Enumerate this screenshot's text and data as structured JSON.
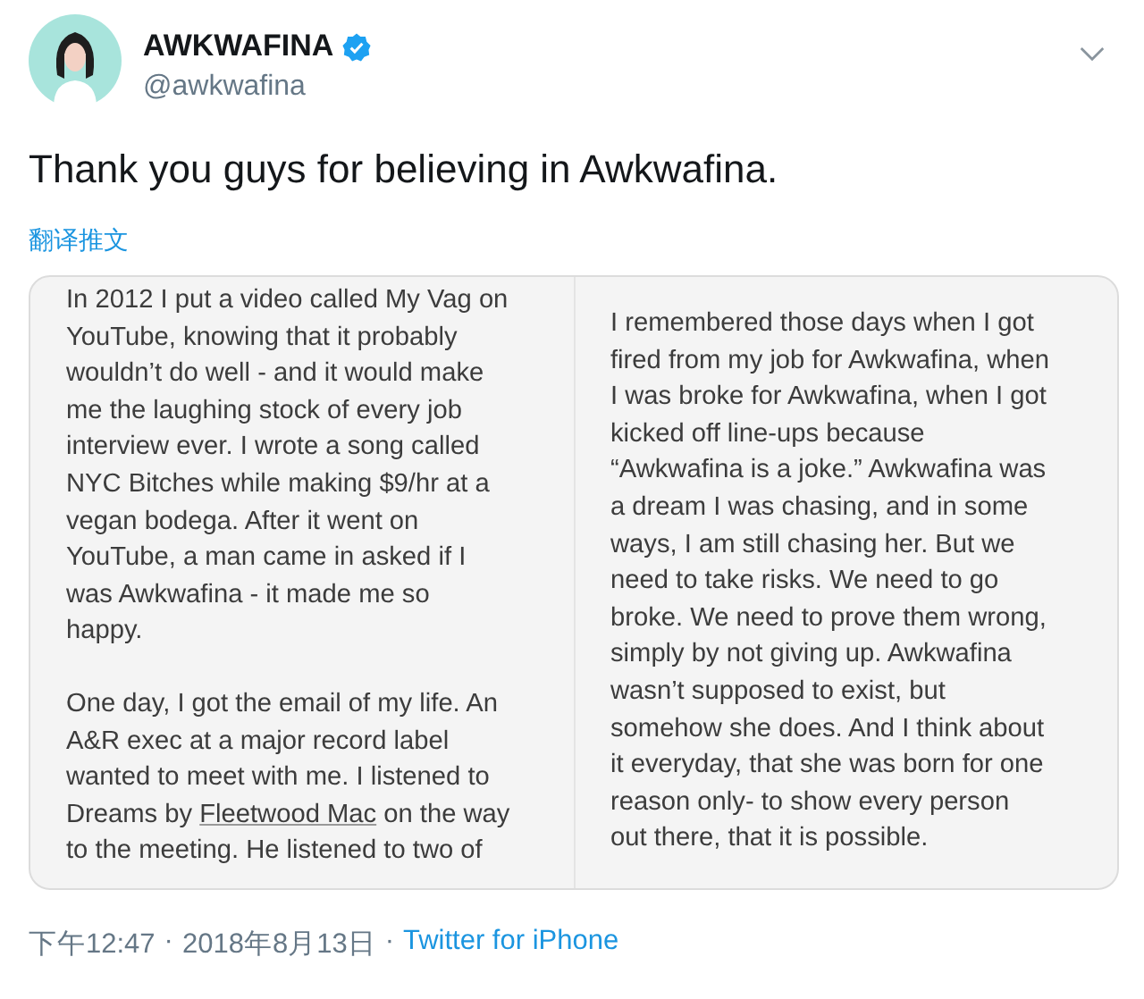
{
  "author": {
    "name": "AWKWAFINA",
    "verified": true,
    "handle": "@awkwafina"
  },
  "tweet_text": "Thank you guys for believing in Awkwafina.",
  "translate_link": "翻译推文",
  "attached_note": {
    "panels": [
      {
        "paragraphs": [
          [
            {
              "text": "In 2012 I put a video called My Vag on\nYouTube, knowing that it probably\nwouldn’t do well - and it would make\nme the laughing stock of every job\ninterview ever. I wrote a song called\nNYC Bitches while making $9/hr at a\nvegan bodega. After it went on\nYouTube, a man came in asked if I\nwas Awkwafina - it made me so\nhappy.",
              "underlined": false
            }
          ],
          [
            {
              "text": "One day, I got the email of my life. An\nA&R exec at a major record label\nwanted to meet with me. I listened to\nDreams by ",
              "underlined": false
            },
            {
              "text": "Fleetwood Mac",
              "underlined": true
            },
            {
              "text": " on the way\nto the meeting. He listened to two of",
              "underlined": false
            }
          ]
        ]
      },
      {
        "paragraphs": [
          [
            {
              "text": "I remembered those days when I got\nfired from my job for Awkwafina, when\nI was broke for Awkwafina, when I got\nkicked off line-ups because\n“Awkwafina is a joke.” Awkwafina was\na dream I was chasing, and in some\nways, I am still chasing her. But we\nneed to take risks. We need to go\nbroke. We need to prove them wrong,\nsimply by not giving up. Awkwafina\nwasn’t supposed to exist, but\nsomehow she does. And I think about\nit everyday, that she was born for one\nreason only-  to show every person\nout there, that it is possible.",
              "underlined": false
            }
          ]
        ]
      }
    ]
  },
  "footer": {
    "time": "下午12:47",
    "separator_1": "·",
    "date": "2018年8月13日",
    "separator_2": "·",
    "source": "Twitter for iPhone"
  }
}
